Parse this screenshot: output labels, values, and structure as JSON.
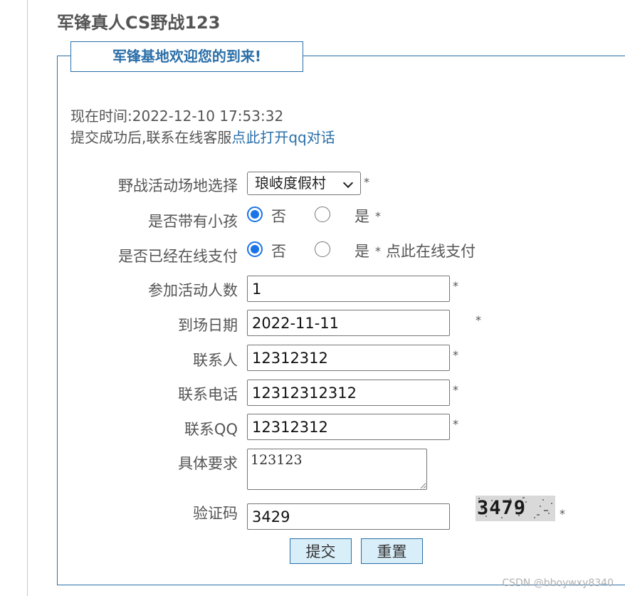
{
  "site_title": "军锋真人CS野战123",
  "welcome": "军锋基地欢迎您的到来!",
  "info": {
    "time_label": "现在时间:",
    "time_value": "2022-12-10 17:53:32",
    "contact_prefix": "提交成功后,联系在线客服",
    "contact_link": "点此打开qq对话"
  },
  "form": {
    "venue": {
      "label": "野战活动场地选择",
      "selected": "琅岐度假村"
    },
    "kids": {
      "label": "是否带有小孩",
      "options": [
        "否",
        "是"
      ],
      "selected": "否"
    },
    "paid": {
      "label": "是否已经在线支付",
      "options": [
        "否",
        "是"
      ],
      "selected": "否",
      "pay_link": "点此在线支付"
    },
    "people": {
      "label": "参加活动人数",
      "value": "1"
    },
    "date": {
      "label": "到场日期",
      "value": "2022-11-11"
    },
    "contact": {
      "label": "联系人",
      "value": "12312312"
    },
    "phone": {
      "label": "联系电话",
      "value": "12312312312"
    },
    "qq": {
      "label": "联系QQ",
      "value": "12312312"
    },
    "requirements": {
      "label": "具体要求",
      "value": "123123"
    },
    "captcha": {
      "label": "验证码",
      "value": "3429",
      "image_text": "3479"
    },
    "required_mark": "*"
  },
  "buttons": {
    "submit": "提交",
    "reset": "重置"
  },
  "watermark": "CSDN @bboywxy8340",
  "colors": {
    "accent": "#2b6fa8",
    "button_bg": "#d8eef9",
    "radio": "#1a73e8"
  }
}
